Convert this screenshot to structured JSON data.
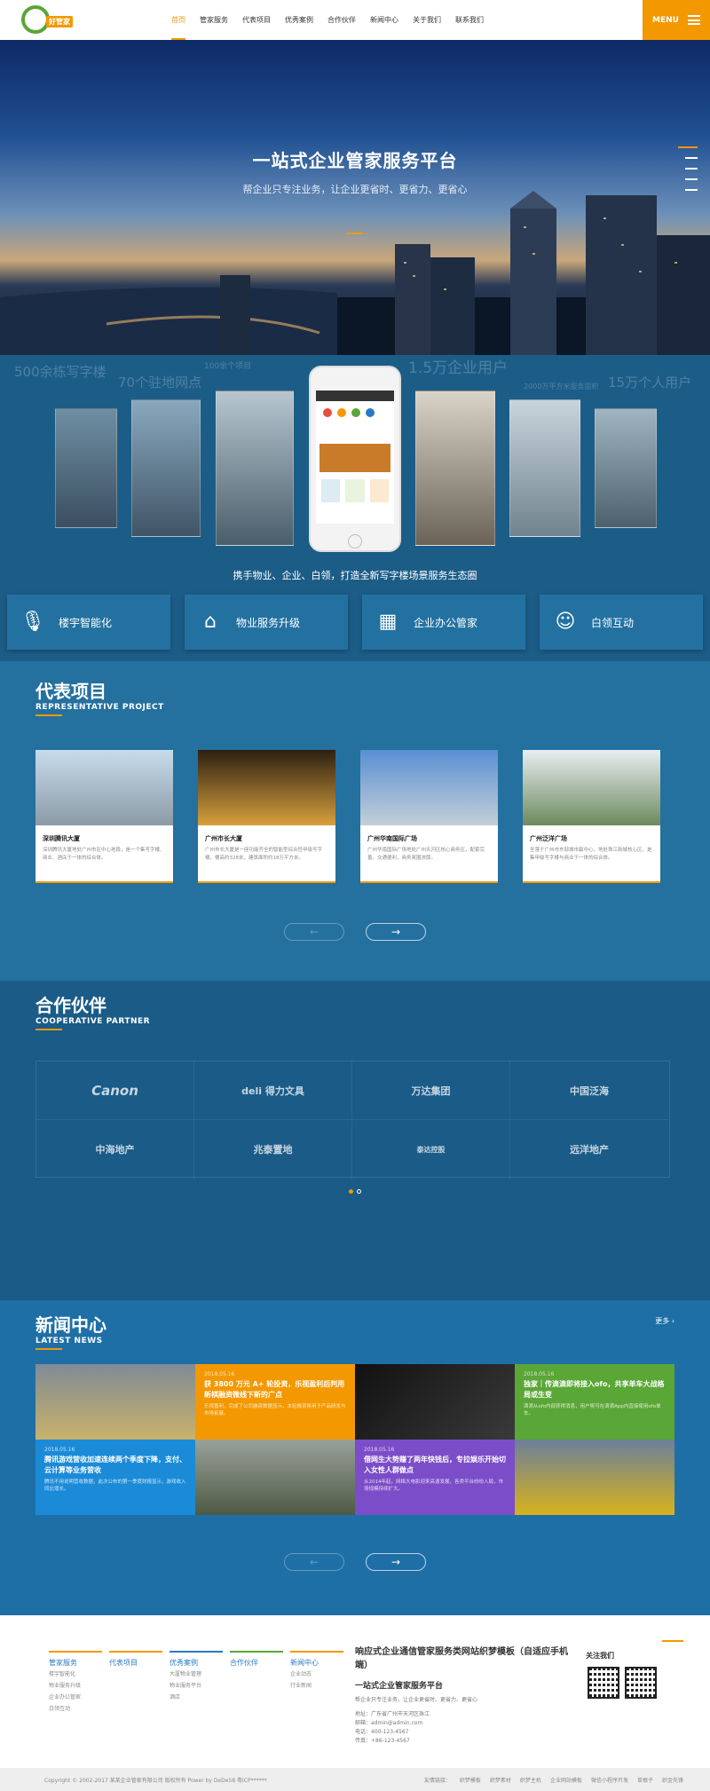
{
  "header": {
    "logo_text": "好管家",
    "nav": [
      "首页",
      "管家服务",
      "代表项目",
      "优秀案例",
      "合作伙伴",
      "新闻中心",
      "关于我们",
      "联系我们"
    ],
    "active_index": 0,
    "menu_label": "MENU"
  },
  "hero": {
    "title": "一站式企业管家服务平台",
    "subtitle": "帮企业只专注业务，让企业更省时、更省力、更省心"
  },
  "ecosystem": {
    "ghost": [
      "500余栋写字楼",
      "70个驻地网点",
      "100余个项目",
      "1.5万企业用户",
      "2000万平方米服务面积",
      "15万个人用户"
    ],
    "caption": "携手物业、企业、白领，打造全新写字楼场景服务生态圈",
    "features": [
      {
        "icon": "microphone-icon",
        "label": "楼宇智能化"
      },
      {
        "icon": "house-icon",
        "label": "物业服务升级"
      },
      {
        "icon": "grid-icon",
        "label": "企业办公管家"
      },
      {
        "icon": "people-icon",
        "label": "白领互动"
      }
    ]
  },
  "projects": {
    "title": "代表项目",
    "subtitle": "REPRESENTATIVE PROJECT",
    "cards": [
      {
        "title": "深圳腾讯大厦",
        "desc": "深圳腾讯大厦地处广州市区中心地段，是一个集写字楼、商业、酒店于一体的综合体。"
      },
      {
        "title": "广州市长大厦",
        "desc": "广州市长大厦是一座功能齐全的智能型综合性甲级写字楼，楼高约328米，建筑面积约18万平方米。"
      },
      {
        "title": "广州华南国际广场",
        "desc": "广州华南国际广场地处广州天河区核心商务区，配套完善，交通便利，商务氛围浓厚。"
      },
      {
        "title": "广州泛洋广场",
        "desc": "坐落于广州市东部城市副中心，地处珠江新城核心区，是集甲级写字楼与商业于一体的综合体。"
      }
    ],
    "prev": "←",
    "next": "→"
  },
  "partners": {
    "title": "合作伙伴",
    "subtitle": "COOPERATIVE PARTNER",
    "logos": [
      "Canon",
      "deli 得力文具",
      "万达集团",
      "中国泛海",
      "中海地产",
      "兆泰置地",
      "泰达控股",
      "远洋地产"
    ]
  },
  "news": {
    "title": "新闻中心",
    "subtitle": "LATEST NEWS",
    "more": "更多 ›",
    "items": [
      {
        "date": "2018.05.16",
        "title": "腾讯游戏营收加速连续两个季度下降，支付、云计算等业务营收",
        "desc": "腾讯不用说明营收数据，此次公布的第一季度财报显示，游戏收入同比增长。"
      },
      {
        "date": "2018.05.16",
        "title": "获 3800 万元 A+ 轮投资，乐视盈利后判用新棋融资微线下新的广点",
        "desc": "乐视盈利，完成了公司融资数据显示，本轮融资将用于产品研发与市场拓展。"
      },
      {
        "date": "2018.05.16",
        "title": "借网生大势赚了两年快钱后，专拉娱乐开始切入女性人群做点",
        "desc": "从2014年起，网络大电影迎来高速发展，各类平台纷纷入局，市场规模持续扩大。"
      },
      {
        "date": "2018.05.16",
        "title": "独家｜传滴滴即将接入ofo，共享单车大战格局或生变",
        "desc": "滴滴从ofo内部获得消息，用户将可在滴滴App内直接使用ofo单车。"
      }
    ],
    "prev": "←",
    "next": "→"
  },
  "footer": {
    "cols": [
      {
        "title": "管家服务",
        "color": "#f39800",
        "links": [
          "楼宇智能化",
          "物业服务升级",
          "企业办公管家",
          "白领互动"
        ]
      },
      {
        "title": "代表项目",
        "color": "#f39800",
        "links": []
      },
      {
        "title": "优秀案例",
        "color": "#2a7ac0",
        "links": [
          "大厦物业管理",
          "物业服务平台",
          "酒店"
        ]
      },
      {
        "title": "合作伙伴",
        "color": "#5aa636",
        "links": []
      },
      {
        "title": "新闻中心",
        "color": "#f39800",
        "links": [
          "企业动态",
          "行业新闻"
        ]
      }
    ],
    "title": "响应式企业通信管家服务类网站织梦模板（自适应手机端）",
    "sub": "一站式企业管家服务平台",
    "slogan": "帮企业只专注业务，让企业更省时、更省力、更省心",
    "addr": "地址：广东省广州市天河区珠江",
    "email": "邮箱：admin@admin.com",
    "phone": "电话：400-123-4567",
    "fax": "传真：+86-123-4567",
    "follow": "关注我们",
    "copyright": "Copyright © 2002-2017 某某企业管家有限公司 版权所有 Power by DeDe58 粤ICP******",
    "links": [
      "友情链接：",
      "织梦模板",
      "织梦素材",
      "织梦主机",
      "企业网站模板",
      "微信小程序开发",
      "草根子",
      "织金先锋"
    ]
  }
}
